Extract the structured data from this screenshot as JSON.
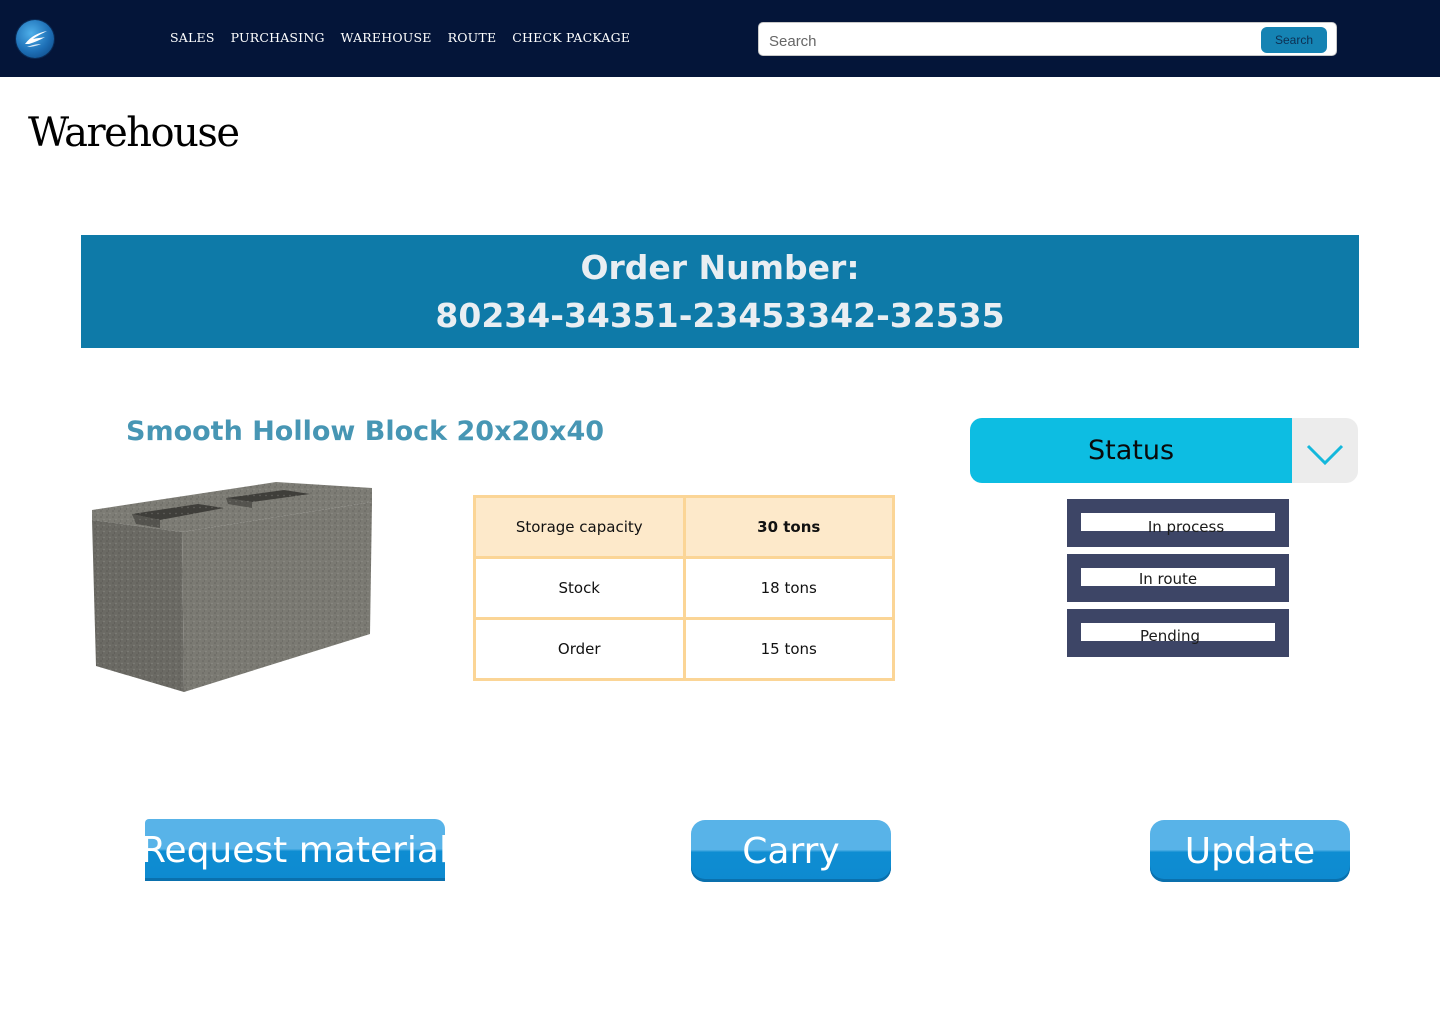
{
  "header": {
    "nav": [
      "SALES",
      "PURCHASING",
      "WAREHOUSE",
      "ROUTE",
      "CHECK PACKAGE"
    ],
    "search": {
      "placeholder": "Search",
      "button_label": "Search"
    }
  },
  "page": {
    "title": "Warehouse"
  },
  "order": {
    "label": "Order Number:",
    "number": "80234-34351-23453342-32535"
  },
  "product": {
    "name": "Smooth Hollow Block 20x20x40",
    "image_icon": "concrete-block-image",
    "table": [
      {
        "label": "Storage capacity",
        "value": "30 tons"
      },
      {
        "label": "Stock",
        "value": "18 tons"
      },
      {
        "label": "Order",
        "value": "15 tons"
      }
    ]
  },
  "status": {
    "label": "Status",
    "options": [
      "In process",
      "In route",
      "Pending"
    ]
  },
  "actions": {
    "request_label": "Request material",
    "carry_label": "Carry",
    "update_label": "Update"
  },
  "colors": {
    "topbar": "#041539",
    "banner": "#0e7aa8",
    "product_title": "#4796b4",
    "status_accent": "#0dbde2",
    "table_border": "#fbd596",
    "option_frame": "#3d4566",
    "button": "#0e8dd2"
  }
}
